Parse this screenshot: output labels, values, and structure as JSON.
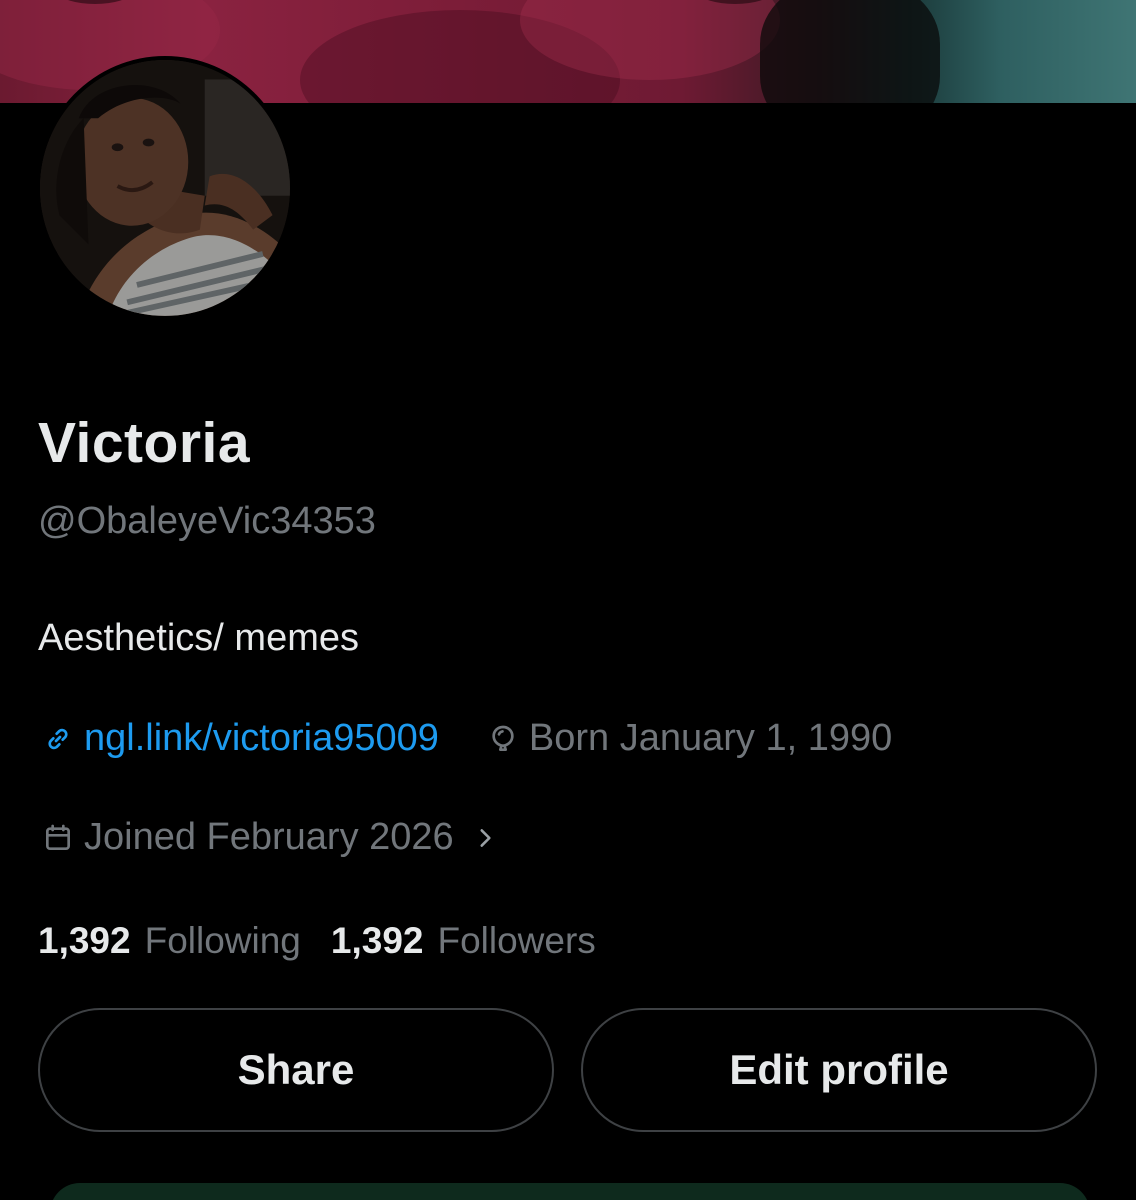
{
  "profile": {
    "name": "Victoria",
    "handle": "@ObaleyeVic34353",
    "bio": "Aesthetics/ memes",
    "link_text": "ngl.link/victoria95009",
    "birthday": "Born January 1, 1990",
    "joined": "Joined February 2026"
  },
  "stats": {
    "following_count": "1,392",
    "following_label": "Following",
    "followers_count": "1,392",
    "followers_label": "Followers"
  },
  "actions": {
    "share_label": "Share",
    "edit_label": "Edit profile"
  },
  "icons": {
    "link": "link-icon",
    "birthday": "balloon-icon",
    "joined": "calendar-icon",
    "more": "chevron-right-icon"
  },
  "colors": {
    "background": "#000000",
    "primary_text": "#e7e9ea",
    "secondary_text": "#71767b",
    "link": "#1d9bf0",
    "button_border": "#3e4144"
  }
}
